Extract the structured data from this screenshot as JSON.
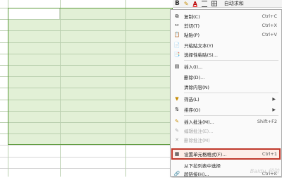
{
  "toolbar": {
    "bold": "B",
    "font_color": "A",
    "autosum": "自动求和"
  },
  "menu": {
    "items": [
      {
        "label": "复制(C)",
        "shortcut": "Ctrl+C",
        "icon": "copy-icon",
        "disabled": false
      },
      {
        "label": "剪切(T)",
        "shortcut": "Ctrl+X",
        "icon": "cut-icon",
        "disabled": false
      },
      {
        "label": "粘贴(P)",
        "shortcut": "Ctrl+V",
        "icon": "paste-icon",
        "disabled": false
      },
      {
        "label": "只粘贴文本(Y)",
        "shortcut": "",
        "icon": "paste-text-icon",
        "disabled": false
      },
      {
        "label": "选择性粘贴(S)...",
        "shortcut": "",
        "icon": "paste-special-icon",
        "disabled": false
      },
      {
        "label": "插入(I)...",
        "shortcut": "",
        "icon": "insert-icon",
        "disabled": false
      },
      {
        "label": "删除(D)...",
        "shortcut": "",
        "icon": "delete-icon",
        "disabled": false
      },
      {
        "label": "清除内容(N)",
        "shortcut": "",
        "icon": "clear-icon",
        "disabled": false
      },
      {
        "label": "筛选(L)",
        "shortcut": "",
        "icon": "filter-icon",
        "disabled": false,
        "submenu": true
      },
      {
        "label": "排序(O)",
        "shortcut": "",
        "icon": "sort-icon",
        "disabled": false,
        "submenu": true
      },
      {
        "label": "插入批注(M)...",
        "shortcut": "Shift+F2",
        "icon": "comment-icon",
        "disabled": false
      },
      {
        "label": "编辑批注(E)...",
        "shortcut": "",
        "icon": "edit-comment-icon",
        "disabled": true
      },
      {
        "label": "删除批注(M)",
        "shortcut": "",
        "icon": "delete-comment-icon",
        "disabled": true
      },
      {
        "label": "设置单元格格式(F)...",
        "shortcut": "Ctrl+1",
        "icon": "format-cells-icon",
        "disabled": false
      },
      {
        "label": "从下拉列表中选择",
        "shortcut": "",
        "icon": "",
        "disabled": false
      },
      {
        "label": "超链接(H)...",
        "shortcut": "Ctrl+K",
        "icon": "hyperlink-icon",
        "disabled": false
      }
    ]
  },
  "watermark": "Baidu 经验"
}
